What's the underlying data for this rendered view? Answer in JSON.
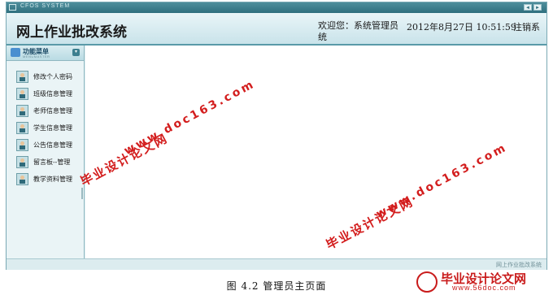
{
  "window": {
    "system_label": "CFOS SYSTEM",
    "nav_prev": "◄",
    "nav_next": "►"
  },
  "header": {
    "app_title": "网上作业批改系统",
    "welcome": "欢迎您：系统管理员统",
    "datetime": "2012年8月27日  10:51:59",
    "logout": "注销系"
  },
  "sidebar": {
    "title": "功能菜单",
    "subtitle": "MENUMASTER",
    "collapse_glyph": "▾",
    "items": [
      {
        "label": "修改个人密码"
      },
      {
        "label": "班级信息管理"
      },
      {
        "label": "老师信息管理"
      },
      {
        "label": "学生信息管理"
      },
      {
        "label": "公告信息管理"
      },
      {
        "label": "留言板--管理"
      },
      {
        "label": "教学资料管理"
      }
    ]
  },
  "footer": {
    "text": "网上作业批改系统"
  },
  "watermarks": {
    "cn": "毕业设计论文网",
    "url": "www.doc163.com"
  },
  "caption": "图 4.2 管理员主页面",
  "logo": {
    "text": "毕业设计论文网",
    "url": "www.56doc.com"
  },
  "colors": {
    "accent": "#2f6f7e",
    "watermark": "#d31d1d",
    "header_bg": "#c9e3ea"
  }
}
